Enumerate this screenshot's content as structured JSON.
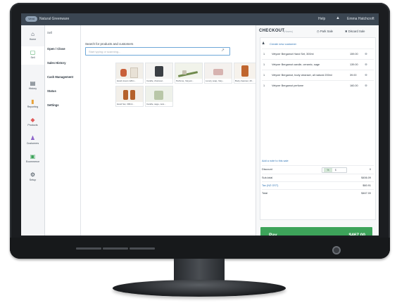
{
  "topbar": {
    "brand_badge": "Vend",
    "store_name": "Natural Greenware",
    "help": "Help",
    "user": "Emma Hatchcroft",
    "bell_icon": "bell-icon"
  },
  "rail": [
    {
      "label": "Home",
      "icon": "home-icon"
    },
    {
      "label": "Sell",
      "icon": "sell-icon"
    },
    {
      "label": "History",
      "icon": "history-icon"
    },
    {
      "label": "Reporting",
      "icon": "reporting-icon"
    },
    {
      "label": "Products",
      "icon": "products-icon"
    },
    {
      "label": "Customers",
      "icon": "customers-icon"
    },
    {
      "label": "Ecommerce",
      "icon": "ecommerce-icon"
    },
    {
      "label": "Setup",
      "icon": "setup-icon"
    }
  ],
  "submenu": [
    "Sell",
    "Open / Close",
    "Sales History",
    "Cash Management",
    "Status",
    "Settings"
  ],
  "search": {
    "label": "Search for products and customers",
    "placeholder": "Start typing or scanning..."
  },
  "products": [
    {
      "label": "Hand cream 120m..."
    },
    {
      "label": "Candle, charcoal..."
    },
    {
      "label": "Perfume, Vetyver..."
    },
    {
      "label": "Luxury soap, Vety..."
    },
    {
      "label": "Body cleanser, 20..."
    },
    {
      "label": "Hand Set, 300ml..."
    },
    {
      "label": "Candle, sage, cera..."
    }
  ],
  "checkout": {
    "title": "CHECKOUT",
    "subtitle": "(Hovers)",
    "park_sale": "Park Sale",
    "discard_sale": "Discard Sale",
    "add_customer": "Create new customer",
    "lines": [
      {
        "qty": "1",
        "name": "Vetyver Bergamot Hand Set, 300ml",
        "price": "159.00"
      },
      {
        "qty": "1",
        "name": "Vetyver Bergamot candle, ceramic, sage",
        "price": "139.00"
      },
      {
        "qty": "1",
        "name": "Vetyver Bergamot, body cleanser, all natural 200ml",
        "price": "39.00"
      },
      {
        "qty": "1",
        "name": "Vetyver Bergamot perfume",
        "price": "160.00"
      }
    ],
    "note_link": "Add a note to this sale",
    "discount_label": "Discount",
    "discount_pct": "%",
    "discount_dollar": "$",
    "discount_value": "0",
    "subtotal_label": "Sub-total",
    "subtotal": "$456.09",
    "tax_label": "Tax (NZ GST)",
    "tax": "$60.91",
    "total_label": "Total",
    "total": "$467.00",
    "pay_label": "Pay",
    "pay_amount": "$467.00"
  }
}
